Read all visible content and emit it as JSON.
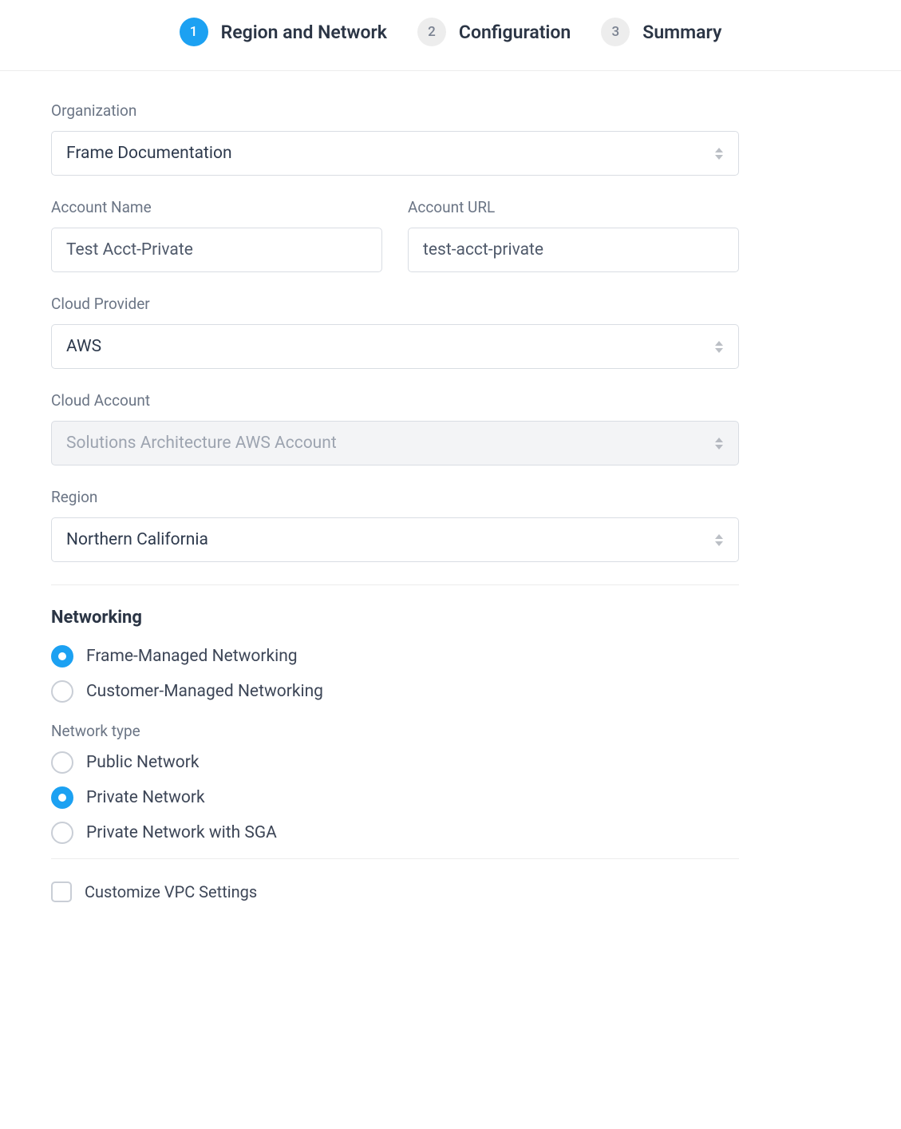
{
  "stepper": {
    "steps": [
      {
        "num": "1",
        "label": "Region and Network",
        "active": true
      },
      {
        "num": "2",
        "label": "Configuration",
        "active": false
      },
      {
        "num": "3",
        "label": "Summary",
        "active": false
      }
    ]
  },
  "organization": {
    "label": "Organization",
    "value": "Frame Documentation"
  },
  "accountName": {
    "label": "Account Name",
    "value": "Test Acct-Private"
  },
  "accountUrl": {
    "label": "Account URL",
    "value": "test-acct-private"
  },
  "cloudProvider": {
    "label": "Cloud Provider",
    "value": "AWS"
  },
  "cloudAccount": {
    "label": "Cloud Account",
    "value": "Solutions Architecture AWS Account"
  },
  "region": {
    "label": "Region",
    "value": "Northern California"
  },
  "networking": {
    "title": "Networking",
    "management": [
      {
        "label": "Frame-Managed Networking",
        "checked": true
      },
      {
        "label": "Customer-Managed Networking",
        "checked": false
      }
    ],
    "networkTypeLabel": "Network type",
    "networkTypes": [
      {
        "label": "Public Network",
        "checked": false
      },
      {
        "label": "Private Network",
        "checked": true
      },
      {
        "label": "Private Network with SGA",
        "checked": false
      }
    ],
    "customizeVpc": {
      "label": "Customize VPC Settings",
      "checked": false
    }
  }
}
